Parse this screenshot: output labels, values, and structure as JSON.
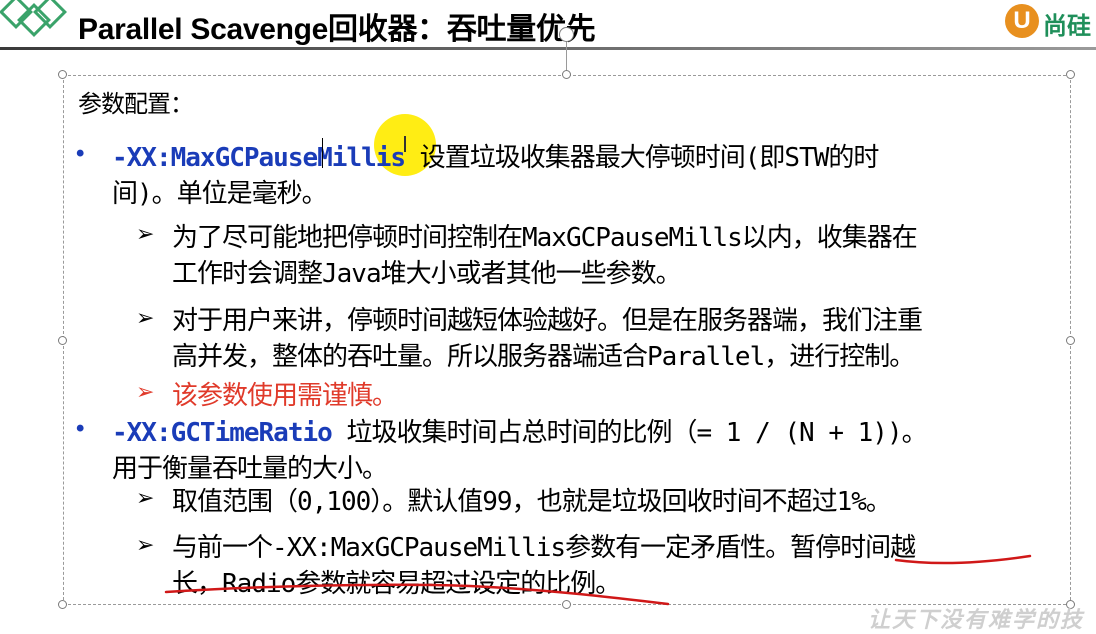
{
  "slide": {
    "title": "Parallel Scavenge回收器：吞吐量优先",
    "brand_logo_text": "尚硅",
    "brand_logo_mark": "U",
    "watermark": "让天下没有难学的技"
  },
  "content": {
    "intro": "参数配置：",
    "item1": {
      "bullet": "•",
      "param": "-XX:MaxGCPauseMillis",
      "desc_line1": " 设置垃圾收集器最大停顿时间(即STW的时",
      "desc_line2": "间)。单位是毫秒。",
      "sub1": {
        "arrow": "➢",
        "line1": "为了尽可能地把停顿时间控制在MaxGCPauseMills以内，收集器在",
        "line2": "工作时会调整Java堆大小或者其他一些参数。"
      },
      "sub2": {
        "arrow": "➢",
        "line1": "对于用户来讲，停顿时间越短体验越好。但是在服务器端，我们注重",
        "line2": "高并发，整体的吞吐量。所以服务器端适合Parallel，进行控制。"
      },
      "sub3": {
        "arrow": "➢",
        "line1": "该参数使用需谨慎。"
      }
    },
    "item2": {
      "bullet": "•",
      "param": "-XX:GCTimeRatio",
      "desc_line1": " 垃圾收集时间占总时间的比例（= 1 / (N + 1))。",
      "desc_line2": "用于衡量吞吐量的大小。",
      "sub1": {
        "arrow": "➢",
        "line1": "取值范围（0,100）。默认值99，也就是垃圾回收时间不超过1%。"
      },
      "sub2": {
        "arrow": "➢",
        "line1": "与前一个-XX:MaxGCPauseMillis参数有一定矛盾性。暂停时间越",
        "line2": "长，Radio参数就容易超过设定的比例。"
      }
    }
  },
  "colors": {
    "param_blue": "#1a3cb8",
    "warning_red": "#e03a2a",
    "annotation_red": "#d01818",
    "highlight_yellow": "#ffec00",
    "brand_orange": "#e8901f",
    "brand_green": "#1f8f5a"
  }
}
